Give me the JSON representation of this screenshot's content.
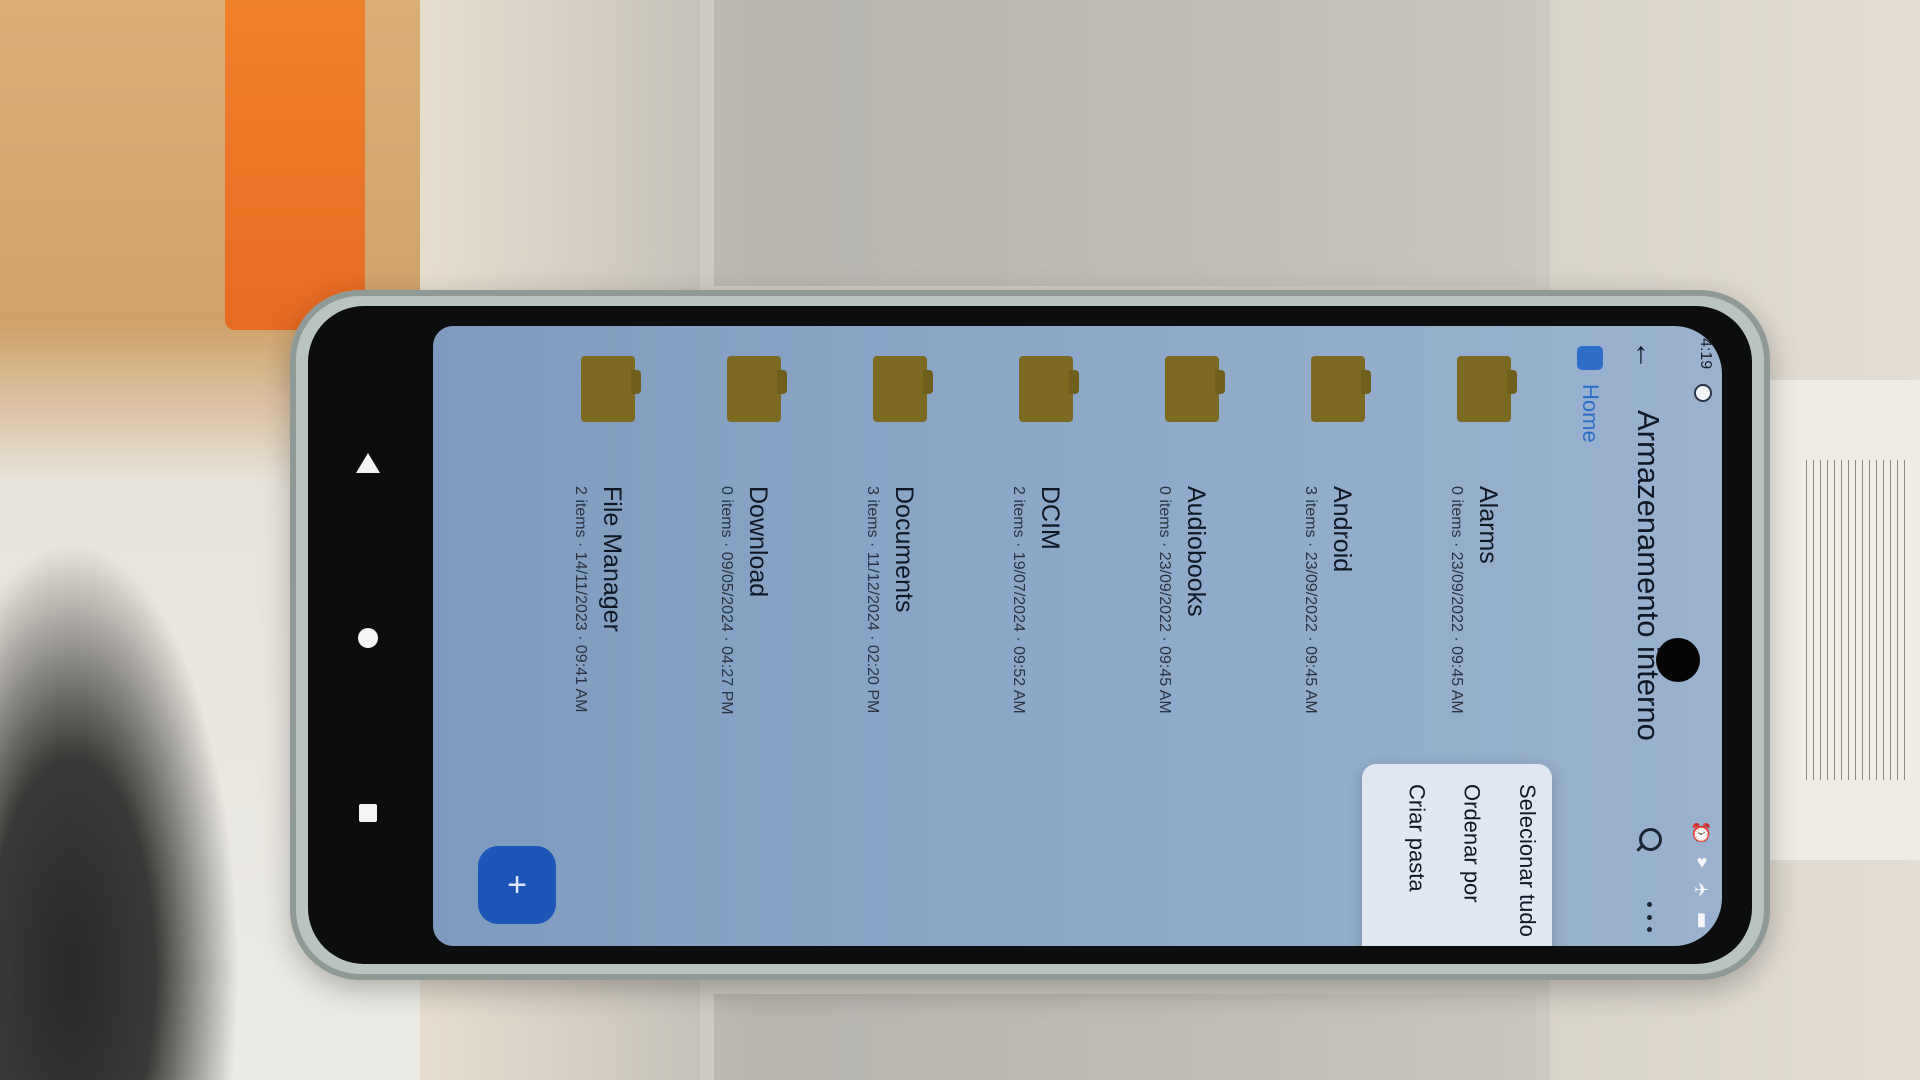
{
  "status_bar": {
    "time": "4:19",
    "icons": [
      "alarm-icon",
      "wifi-icon",
      "airplane-icon",
      "battery-icon"
    ]
  },
  "app_bar": {
    "title": "Armazenamento interno"
  },
  "breadcrumb": {
    "label": "Home"
  },
  "files": [
    {
      "name": "Alarms",
      "meta": "0 items · 23/09/2022 · 09:45 AM"
    },
    {
      "name": "Android",
      "meta": "3 items · 23/09/2022 · 09:45 AM"
    },
    {
      "name": "Audiobooks",
      "meta": "0 items · 23/09/2022 · 09:45 AM"
    },
    {
      "name": "DCIM",
      "meta": "2 items · 19/07/2024 · 09:52 AM"
    },
    {
      "name": "Documents",
      "meta": "3 items · 11/12/2024 · 02:20 PM"
    },
    {
      "name": "Download",
      "meta": "0 items · 09/05/2024 · 04:27 PM"
    },
    {
      "name": "File Manager",
      "meta": "2 items · 14/11/2023 · 09:41 AM"
    }
  ],
  "overflow_menu": {
    "items": [
      "Selecionar tudo",
      "Ordenar por",
      "Criar pasta"
    ]
  },
  "fab": {
    "label": "+"
  },
  "colors": {
    "accent": "#2f6ec8",
    "folder": "#7c6a22",
    "fab": "#1e55b9"
  }
}
